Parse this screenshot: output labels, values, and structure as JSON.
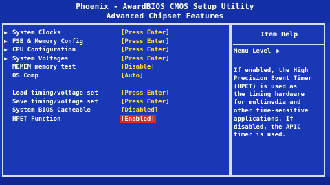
{
  "header": {
    "title": "Phoenix - AwardBIOS CMOS Setup Utility",
    "subtitle": "Advanced Chipset Features"
  },
  "menu": {
    "items": [
      {
        "label": "System Clocks",
        "value": "[Press Enter]",
        "submenu": true
      },
      {
        "label": "FSB & Memory Config",
        "value": "[Press Enter]",
        "submenu": true
      },
      {
        "label": "CPU Configuration",
        "value": "[Press Enter]",
        "submenu": true
      },
      {
        "label": "System Voltages",
        "value": "[Press Enter]",
        "submenu": true
      },
      {
        "label": "MEMEM memory test",
        "value": "[Disable]",
        "submenu": false
      },
      {
        "label": "OS Comp",
        "value": "[Auto]",
        "submenu": false
      },
      {
        "label": "Load timing/voltage set",
        "value": "[Press Enter]",
        "submenu": false
      },
      {
        "label": "Save timing/voltage set",
        "value": "[Press Enter]",
        "submenu": false
      },
      {
        "label": "System BIOS Cacheable",
        "value": "[Disabled]",
        "submenu": false
      },
      {
        "label": "HPET Function",
        "value": "[Enabled]",
        "submenu": false,
        "selected": true
      }
    ]
  },
  "help": {
    "title": "Item Help",
    "menu_level_label": "Menu Level",
    "menu_level_marker": "▶",
    "text": "If enabled, the High\nPrecision Event Timer\n(HPET) is used as\nthe timing hardware\nfor multimedia and\nother time-sensitive\napplications. If\ndisabled, the APIC\ntimer is used."
  },
  "colors": {
    "background": "#1838b6",
    "text": "#ffffff",
    "value": "#ffe033",
    "highlight": "#e0281e",
    "border": "#d9dde8"
  },
  "icons": {
    "submenu": "triangle-right-icon"
  }
}
